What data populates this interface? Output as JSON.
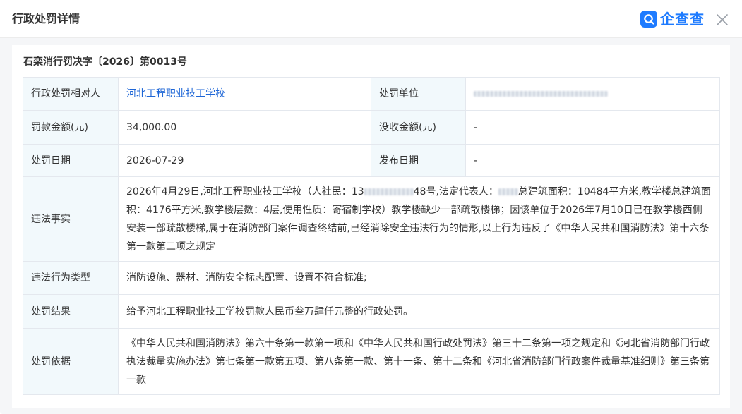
{
  "header": {
    "title": "行政处罚详情",
    "brand_name": "企查查"
  },
  "document": {
    "decision_number": "石栾消行罚决字〔2026〕第0013号"
  },
  "rows": {
    "subject": {
      "label": "行政处罚相对人",
      "value": "河北工程职业技工学校"
    },
    "authority": {
      "label": "处罚单位",
      "value": ""
    },
    "fine": {
      "label": "罚款金额(元)",
      "value": "34,000.00"
    },
    "confiscation": {
      "label": "没收金额(元)",
      "value": "-"
    },
    "penalty_date": {
      "label": "处罚日期",
      "value": "2026-07-29"
    },
    "publish_date": {
      "label": "发布日期",
      "value": "-"
    },
    "facts": {
      "label": "违法事实",
      "part1": "2026年4月29日,河北工程职业技工学校（人社民：",
      "part2": "13",
      "part3": "48号,法定代表人：",
      "part4": "总建筑面积：10484平方米,教学楼总建筑面积：4176平方米,教学楼层数：4层,使用性质：寄宿制学校）教学楼缺少一部疏散楼梯；因该单位于2026年7月10日已在教学楼西侧安装一部疏散楼梯,属于在消防部门案件调查终结前,已经消除安全违法行为的情形,以上行为违反了《中华人民共和国消防法》第十六条第一款第二项之规定"
    },
    "violation_type": {
      "label": "违法行为类型",
      "value": "消防设施、器材、消防安全标志配置、设置不符合标准;"
    },
    "result": {
      "label": "处罚结果",
      "value": "给予河北工程职业技工学校罚款人民币叁万肆仟元整的行政处罚。"
    },
    "basis": {
      "label": "处罚依据",
      "value": "《中华人民共和国消防法》第六十条第一款第一项和《中华人民共和国行政处罚法》第三十二条第一项之规定和《河北省消防部门行政执法裁量实施办法》第七条第一款第五项、第八条第一款、第十一条、第十二条和《河北省消防部门行政案件裁量基准细则》第三条第一款"
    }
  },
  "colors": {
    "link": "#1e66d6",
    "brand": "#1e7bff",
    "label_bg": "#f2f9fc",
    "border": "#e4e8ee",
    "page_bg": "#f5f6f8"
  },
  "icons": {
    "brand_logo": "qichacha-logo-icon",
    "close": "close-icon"
  }
}
